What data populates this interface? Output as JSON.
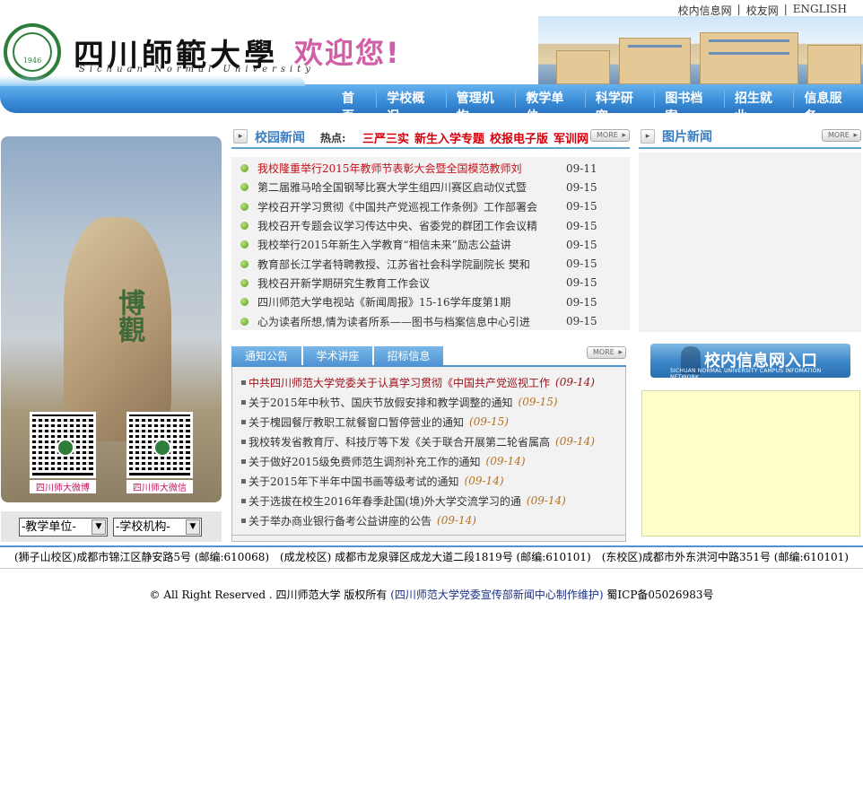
{
  "header": {
    "toplinks": [
      "校内信息网",
      "校友网",
      "ENGLISH"
    ],
    "logo_cn": "四川師範大學",
    "logo_en": "Sichuan Normal University",
    "seal_year": "1946",
    "welcome": "欢迎您!"
  },
  "nav": [
    "首页",
    "学校概况",
    "管理机构",
    "教学单位",
    "科学研究",
    "图书档案",
    "招生就业",
    "信息服务"
  ],
  "left": {
    "rock_text": "博觀",
    "qr_labels": [
      "四川师大微博",
      "四川师大微信"
    ],
    "select_teaching": "-教学单位-",
    "select_org": "-学校机构-"
  },
  "campus_news": {
    "title": "校园新闻",
    "hot_label": "热点:",
    "hot_links": [
      "三严三实",
      "新生入学专题",
      "校报电子版",
      "军训网"
    ],
    "more": "MORE",
    "items": [
      {
        "title": "我校隆重举行2015年教师节表彰大会暨全国模范教师刘",
        "date": "09-11",
        "highlight": true
      },
      {
        "title": "第二届雅马哈全国钢琴比赛大学生组四川赛区启动仪式暨",
        "date": "09-15",
        "highlight": false
      },
      {
        "title": "学校召开学习贯彻《中国共产党巡视工作条例》工作部署会",
        "date": "09-15",
        "highlight": false
      },
      {
        "title": "我校召开专题会议学习传达中央、省委党的群团工作会议精",
        "date": "09-15",
        "highlight": false
      },
      {
        "title": "我校举行2015年新生入学教育“相信未来”励志公益讲",
        "date": "09-15",
        "highlight": false
      },
      {
        "title": "教育部长江学者特聘教授、江苏省社会科学院副院长 樊和",
        "date": "09-15",
        "highlight": false
      },
      {
        "title": "我校召开新学期研究生教育工作会议",
        "date": "09-15",
        "highlight": false
      },
      {
        "title": "四川师范大学电视站《新闻周报》15-16学年度第1期",
        "date": "09-15",
        "highlight": false
      },
      {
        "title": "心为读者所想,情为读者所系——图书与档案信息中心引进",
        "date": "09-15",
        "highlight": false
      }
    ]
  },
  "picture_news": {
    "title": "图片新闻",
    "more": "MORE"
  },
  "notices": {
    "tabs": [
      "通知公告",
      "学术讲座",
      "招标信息"
    ],
    "more": "MORE",
    "items": [
      {
        "title": "中共四川师范大学党委关于认真学习贯彻《中国共产党巡视工作",
        "date": "(09-14)",
        "highlight": true
      },
      {
        "title": "关于2015年中秋节、国庆节放假安排和教学调整的通知",
        "date": "(09-15)",
        "highlight": false
      },
      {
        "title": "关于槐园餐厅教职工就餐窗口暂停营业的通知",
        "date": "(09-15)",
        "highlight": false
      },
      {
        "title": "我校转发省教育厅、科技厅等下发《关于联合开展第二轮省属高",
        "date": "(09-14)",
        "highlight": false
      },
      {
        "title": "关于做好2015级免费师范生调剂补充工作的通知",
        "date": "(09-14)",
        "highlight": false
      },
      {
        "title": "关于2015年下半年中国书画等级考试的通知",
        "date": "(09-14)",
        "highlight": false
      },
      {
        "title": "关于选拔在校生2016年春季赴国(境)外大学交流学习的通",
        "date": "(09-14)",
        "highlight": false
      },
      {
        "title": "关于举办商业银行备考公益讲座的公告",
        "date": "(09-14)",
        "highlight": false
      }
    ]
  },
  "portal": {
    "title": "校内信息网入口",
    "subtitle": "SICHUAN NORMAL UNIVERSITY CAMPUS INFOMATION NETWORK"
  },
  "footer": {
    "addresses": [
      "(狮子山校区)成都市锦江区静安路5号 (邮编:610068)",
      "(成龙校区) 成都市龙泉驿区成龙大道二段1819号 (邮编:610101)",
      "(东校区)成都市外东洪河中路351号 (邮编:610101)"
    ],
    "copyright_prefix": "© All Right Reserved . 四川师范大学  版权所有 ",
    "maker": "(四川师范大学党委宣传部新闻中心制作维护)",
    "icp": " 蜀ICP备05026983号"
  },
  "colors": {
    "nav_blue": "#3c8fd8",
    "hot_red": "#d4000d",
    "welcome_pink": "#d15fa8",
    "seal_green": "#2e7d3a",
    "panel_yellow": "#ffffcc"
  }
}
